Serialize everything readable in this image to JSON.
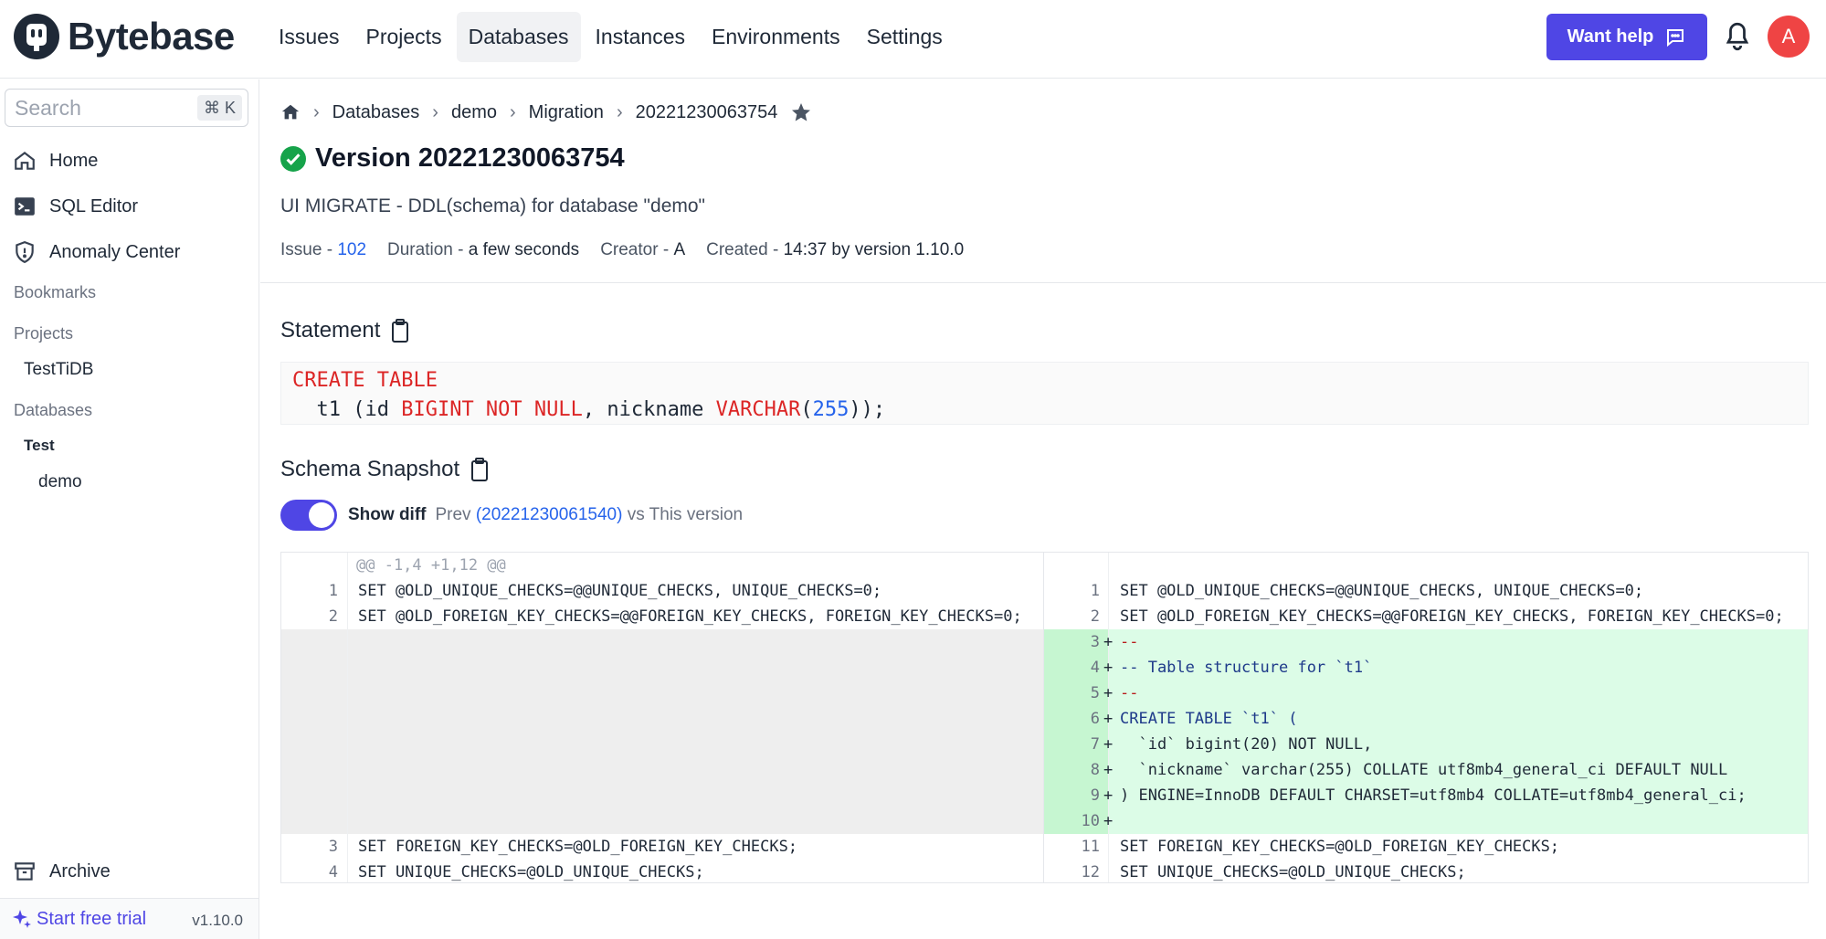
{
  "app": {
    "name": "Bytebase",
    "help_label": "Want help",
    "avatar_initial": "A",
    "accent_color": "#4f46e5"
  },
  "nav": {
    "items": [
      "Issues",
      "Projects",
      "Databases",
      "Instances",
      "Environments",
      "Settings"
    ],
    "active": "Databases"
  },
  "sidebar": {
    "search_placeholder": "Search",
    "search_shortcut": "⌘ K",
    "home": "Home",
    "sql_editor": "SQL Editor",
    "anomaly_center": "Anomaly Center",
    "bookmarks": "Bookmarks",
    "projects": "Projects",
    "project_item": "TestTiDB",
    "databases": "Databases",
    "env_group": "Test",
    "db_item": "demo",
    "archive": "Archive",
    "trial": "Start free trial",
    "version": "v1.10.0"
  },
  "breadcrumb": {
    "items": [
      "Databases",
      "demo",
      "Migration",
      "20221230063754"
    ]
  },
  "page": {
    "title": "Version 20221230063754",
    "subtitle": "UI MIGRATE - DDL(schema) for database \"demo\"",
    "meta": {
      "issue_label": "Issue - ",
      "issue_value": "102",
      "duration_label": "Duration - ",
      "duration_value": "a few seconds",
      "creator_label": "Creator - ",
      "creator_value": "A",
      "created_label": "Created - ",
      "created_value": "14:37 by version 1.10.0"
    },
    "statement_title": "Statement",
    "statement": {
      "line1": "CREATE TABLE",
      "line2_a": "  t1 (id ",
      "line2_b": "BIGINT NOT NULL",
      "line2_c": ", nickname ",
      "line2_d": "VARCHAR",
      "line2_e": "(",
      "line2_f": "255",
      "line2_g": "));"
    },
    "snapshot_title": "Schema Snapshot",
    "show_diff_label": "Show diff",
    "show_diff_on": true,
    "prev_label": "Prev",
    "prev_version": "(20221230061540)",
    "vs_label": "vs This version"
  },
  "diff": {
    "hunk": "@@ -1,4 +1,12 @@",
    "left": [
      {
        "ln": "1",
        "code": "SET @OLD_UNIQUE_CHECKS=@@UNIQUE_CHECKS, UNIQUE_CHECKS=0;"
      },
      {
        "ln": "2",
        "code": "SET @OLD_FOREIGN_KEY_CHECKS=@@FOREIGN_KEY_CHECKS, FOREIGN_KEY_CHECKS=0;"
      },
      {
        "ln": "3",
        "code": "SET FOREIGN_KEY_CHECKS=@OLD_FOREIGN_KEY_CHECKS;"
      },
      {
        "ln": "4",
        "code": "SET UNIQUE_CHECKS=@OLD_UNIQUE_CHECKS;"
      }
    ],
    "right": [
      {
        "ln": "1",
        "sign": " ",
        "code": "SET @OLD_UNIQUE_CHECKS=@@UNIQUE_CHECKS, UNIQUE_CHECKS=0;"
      },
      {
        "ln": "2",
        "sign": " ",
        "code": "SET @OLD_FOREIGN_KEY_CHECKS=@@FOREIGN_KEY_CHECKS, FOREIGN_KEY_CHECKS=0;"
      },
      {
        "ln": "3",
        "sign": "+",
        "code": "--"
      },
      {
        "ln": "4",
        "sign": "+",
        "code": "-- Table structure for `t1`"
      },
      {
        "ln": "5",
        "sign": "+",
        "code": "--"
      },
      {
        "ln": "6",
        "sign": "+",
        "code": "CREATE TABLE `t1` ("
      },
      {
        "ln": "7",
        "sign": "+",
        "code": "  `id` bigint(20) NOT NULL,"
      },
      {
        "ln": "8",
        "sign": "+",
        "code": "  `nickname` varchar(255) COLLATE utf8mb4_general_ci DEFAULT NULL"
      },
      {
        "ln": "9",
        "sign": "+",
        "code": ") ENGINE=InnoDB DEFAULT CHARSET=utf8mb4 COLLATE=utf8mb4_general_ci;"
      },
      {
        "ln": "10",
        "sign": "+",
        "code": ""
      },
      {
        "ln": "11",
        "sign": " ",
        "code": "SET FOREIGN_KEY_CHECKS=@OLD_FOREIGN_KEY_CHECKS;"
      },
      {
        "ln": "12",
        "sign": " ",
        "code": "SET UNIQUE_CHECKS=@OLD_UNIQUE_CHECKS;"
      }
    ]
  }
}
